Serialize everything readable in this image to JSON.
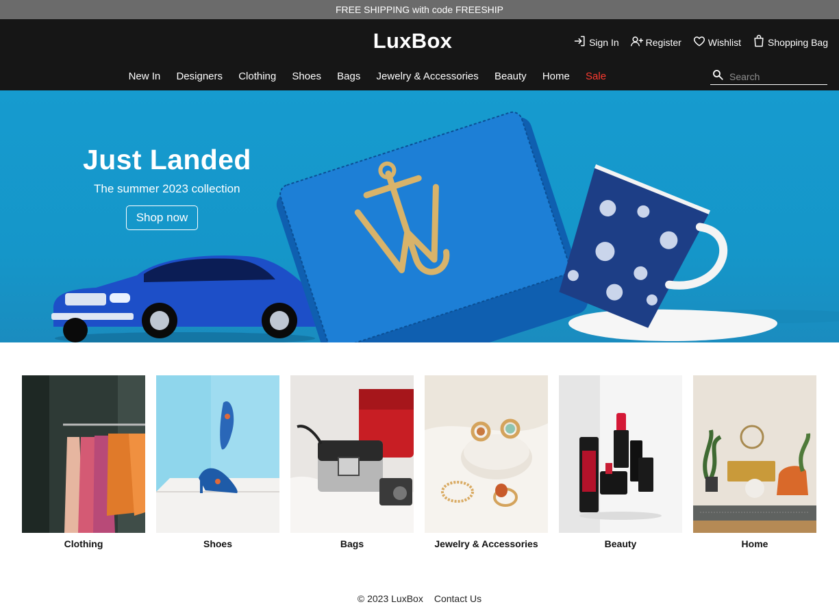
{
  "promo": {
    "text": "FREE SHIPPING with code FREESHIP"
  },
  "brand": {
    "name": "LuxBox"
  },
  "account": {
    "sign_in": "Sign In",
    "register": "Register",
    "wishlist": "Wishlist",
    "bag": "Shopping Bag"
  },
  "nav": {
    "items": [
      "New In",
      "Designers",
      "Clothing",
      "Shoes",
      "Bags",
      "Jewelry & Accessories",
      "Beauty",
      "Home",
      "Sale"
    ]
  },
  "search": {
    "placeholder": "Search",
    "value": ""
  },
  "hero": {
    "title": "Just Landed",
    "subtitle": "The summer 2023 collection",
    "cta": "Shop now"
  },
  "categories": [
    "Clothing",
    "Shoes",
    "Bags",
    "Jewelry & Accessories",
    "Beauty",
    "Home"
  ],
  "footer": {
    "copyright": "© 2023 LuxBox",
    "contact": "Contact Us"
  },
  "colors": {
    "header_bg": "#161616",
    "promo_bg": "#6b6b6b",
    "hero_bg": "#169bcf",
    "sale": "#ff3b30"
  },
  "icons": [
    "sign-in-icon",
    "register-icon",
    "heart-icon",
    "shopping-bag-icon",
    "search-icon"
  ]
}
